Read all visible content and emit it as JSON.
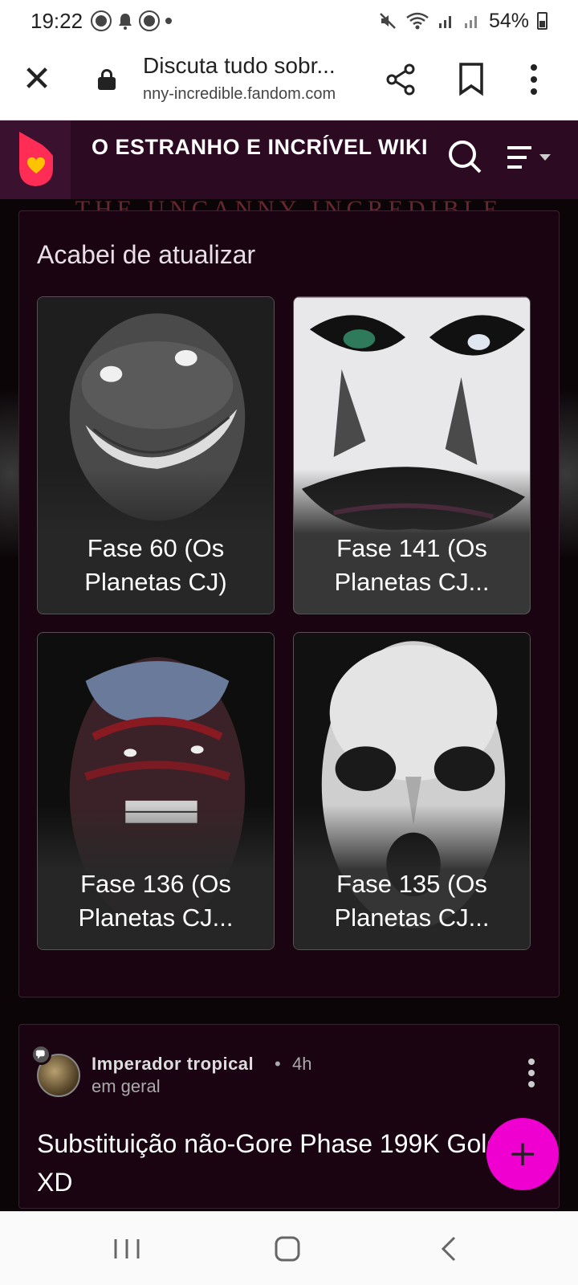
{
  "status_bar": {
    "time": "19:22",
    "battery": "54%",
    "icons": [
      "chrome-icon",
      "bell-icon",
      "chrome-icon",
      "dot-icon",
      "mute-icon",
      "wifi-icon",
      "signal-icon",
      "signal-icon",
      "battery-icon"
    ]
  },
  "browser": {
    "page_title": "Discuta tudo sobr...",
    "url": "nny-incredible.fandom.com"
  },
  "wiki": {
    "title": "O ESTRANHO E INCRÍVEL WIKI",
    "banner_text": "THE UNCANNY INCREDIBLE"
  },
  "updated": {
    "heading": "Acabei de atualizar",
    "cards": [
      {
        "label": "Fase 60 (Os Planetas CJ)"
      },
      {
        "label": "Fase 141 (Os Planetas CJ..."
      },
      {
        "label": "Fase 136 (Os Planetas CJ..."
      },
      {
        "label": "Fase 135 (Os Planetas CJ..."
      }
    ]
  },
  "post": {
    "author": "Imperador tropical",
    "time": "4h",
    "category": "em geral",
    "headline": "Substituição não-Gore Phase 199K Gold XD"
  },
  "colors": {
    "wiki_header_bg": "#2c0a22",
    "panel_bg": "#1a0412",
    "fab": "#f000d0",
    "fandom_logo": "#ff2d55"
  }
}
